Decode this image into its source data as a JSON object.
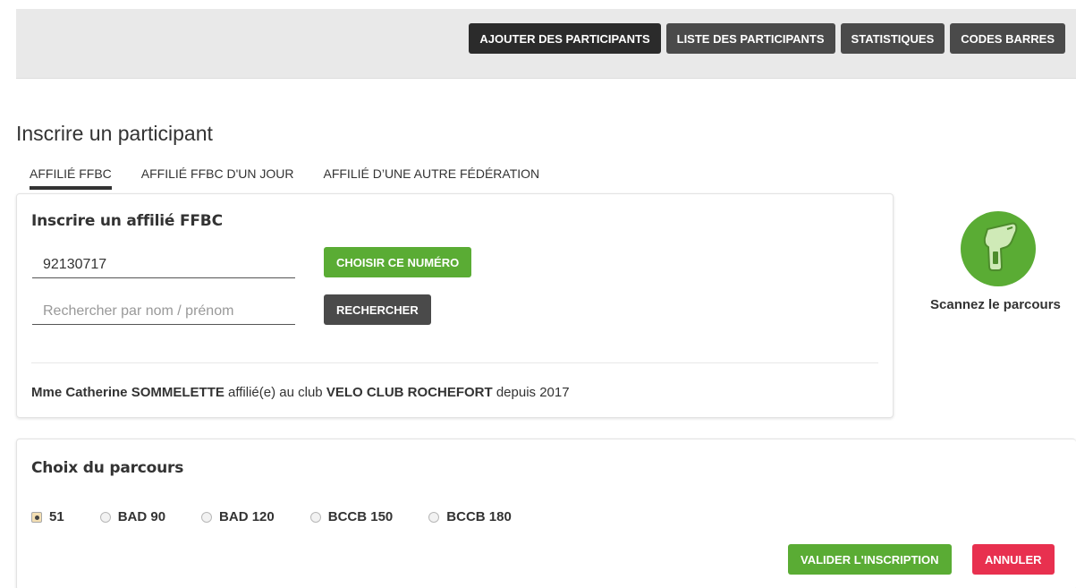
{
  "nav": {
    "items": [
      {
        "label": "AJOUTER DES PARTICIPANTS",
        "active": true
      },
      {
        "label": "LISTE DES PARTICIPANTS",
        "active": false
      },
      {
        "label": "STATISTIQUES",
        "active": false
      },
      {
        "label": "CODES BARRES",
        "active": false
      }
    ]
  },
  "page": {
    "title": "Inscrire un participant"
  },
  "tabs": [
    {
      "label": "AFFILIÉ FFBC",
      "active": true
    },
    {
      "label": "AFFILIÉ FFBC D'UN JOUR",
      "active": false
    },
    {
      "label": "AFFILIÉ D’UNE AUTRE FÉDÉRATION",
      "active": false
    }
  ],
  "register": {
    "title": "Inscrire un affilié FFBC",
    "number_value": "92130717",
    "choose_label": "CHOISIR CE NUMÉRO",
    "search_placeholder": "Rechercher par nom / prénom",
    "search_label": "RECHERCHER",
    "member": {
      "name": "Mme Catherine SOMMELETTE",
      "text1": " affilié(e) au club ",
      "club": "VELO CLUB ROCHEFORT",
      "text2": " depuis 2017"
    }
  },
  "scanner": {
    "label": "Scannez le parcours",
    "icon": "barcode-scanner-icon"
  },
  "route": {
    "title": "Choix du parcours",
    "options": [
      {
        "label": "51",
        "checked": true
      },
      {
        "label": "BAD 90",
        "checked": false
      },
      {
        "label": "BAD 120",
        "checked": false
      },
      {
        "label": "BCCB 150",
        "checked": false
      },
      {
        "label": "BCCB 180",
        "checked": false
      }
    ],
    "validate_label": "VALIDER L'INSCRIPTION",
    "cancel_label": "ANNULER"
  },
  "colors": {
    "green": "#5aac34",
    "dark": "#4a4a4a",
    "active_dark": "#2b2b2b",
    "red": "#e8304f"
  }
}
